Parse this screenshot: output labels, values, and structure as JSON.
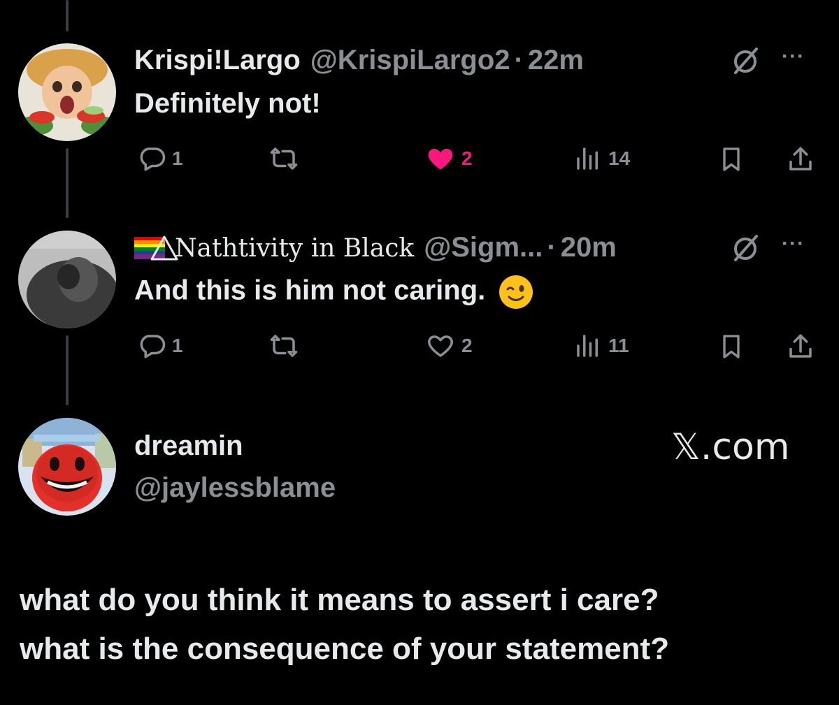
{
  "tweets": [
    {
      "name": "Krispi!Largo",
      "handle": "@KrispiLargo2",
      "dot": "·",
      "time": "22m",
      "text": "Definitely not!",
      "replies": "1",
      "likes": "2",
      "liked": true,
      "views": "14"
    },
    {
      "name": "Nathtivity in Black",
      "handle": "@Sigm...",
      "dot": "·",
      "time": "20m",
      "text": "And this is him not caring.",
      "replies": "1",
      "likes": "2",
      "liked": false,
      "views": "11"
    }
  ],
  "reply_author": {
    "name": "dreamin",
    "handle": "@jaylessblame"
  },
  "brand": "𝕏.com",
  "reply_text": {
    "line1": "what do you think it means to assert i care?",
    "line2": "what is the consequence of your statement?"
  },
  "more_label": "···",
  "colors": {
    "background": "#000000",
    "text": "#e7e9ea",
    "muted": "#8b8f94",
    "like_active": "#f91880",
    "thread_line": "#3a3d41"
  },
  "icons": [
    "reply-icon",
    "retweet-icon",
    "heart-icon",
    "views-icon",
    "bookmark-icon",
    "share-icon",
    "grok-icon",
    "more-icon"
  ]
}
